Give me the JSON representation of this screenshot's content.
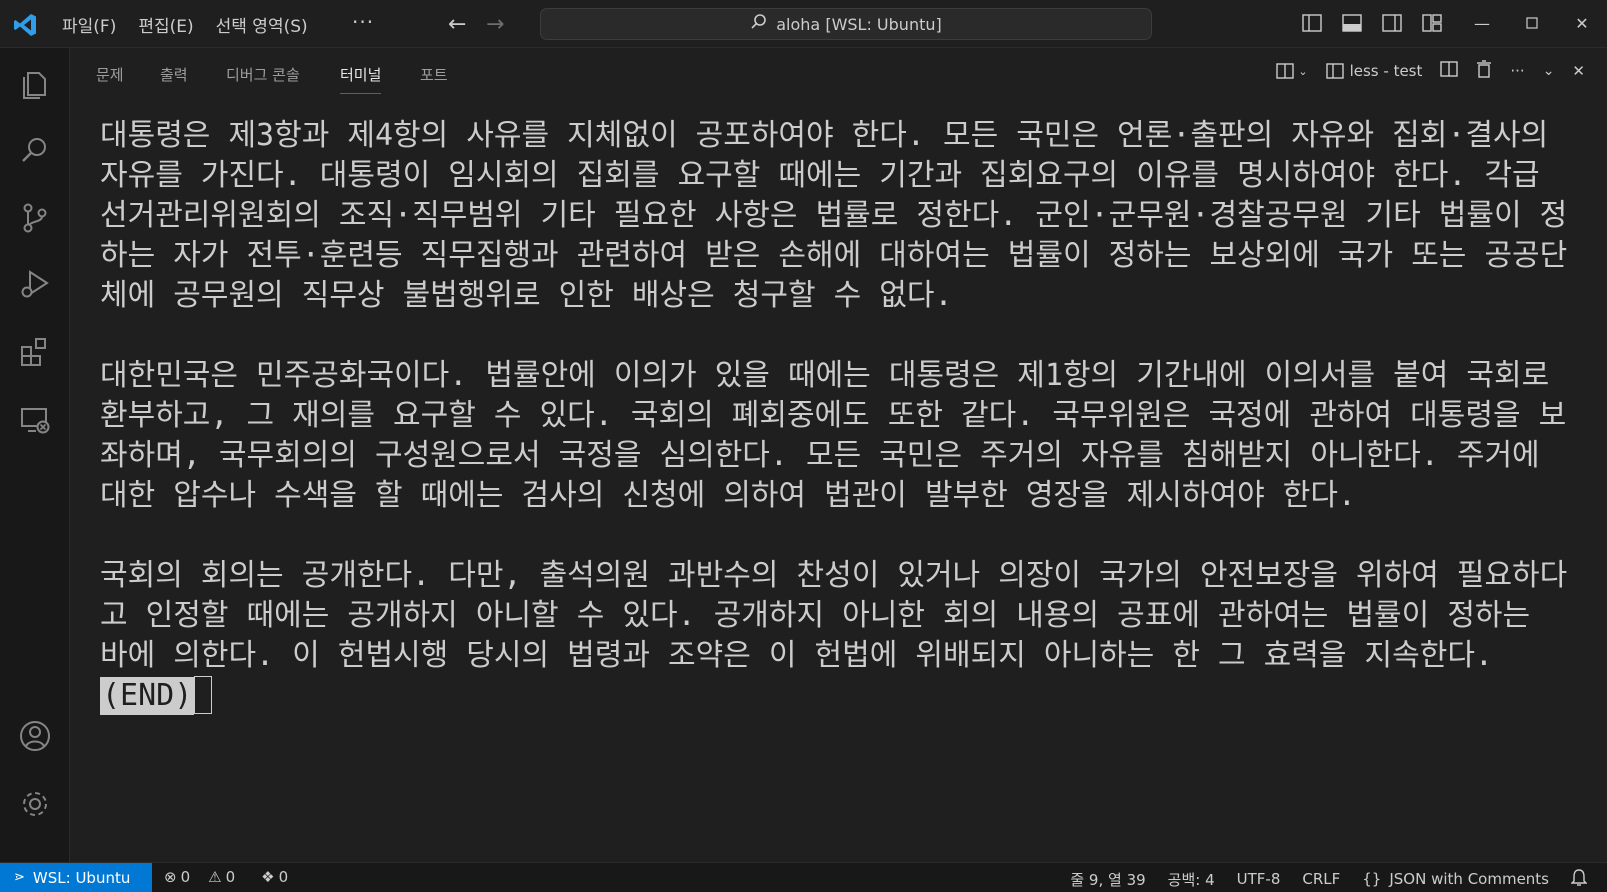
{
  "titlebar": {
    "menu": [
      "파일(F)",
      "편집(E)",
      "선택 영역(S)"
    ],
    "more": "···",
    "search_text": "aloha [WSL: Ubuntu]"
  },
  "panel": {
    "tabs": [
      "문제",
      "출력",
      "디버그 콘솔",
      "터미널",
      "포트"
    ],
    "active_tab": "터미널",
    "terminal_name": "less - test"
  },
  "terminal": {
    "paragraphs": [
      "대통령은 제3항과 제4항의 사유를 지체없이 공포하여야 한다. 모든 국민은 언론·출판의 자유와 집회·결사의 자유를 가진다. 대통령이 임시회의 집회를 요구할 때에는 기간과 집회요구의 이유를 명시하여야 한다. 각급 선거관리위원회의 조직·직무범위 기타 필요한 사항은 법률로 정한다. 군인·군무원·경찰공무원 기타 법률이 정하는 자가 전투·훈련등 직무집행과 관련하여 받은 손해에 대하여는 법률이 정하는 보상외에 국가 또는 공공단체에 공무원의 직무상 불법행위로 인한 배상은 청구할 수 없다.",
      "대한민국은 민주공화국이다. 법률안에 이의가 있을 때에는 대통령은 제1항의 기간내에 이의서를 붙여 국회로 환부하고, 그 재의를 요구할 수 있다. 국회의 폐회중에도 또한 같다. 국무위원은 국정에 관하여 대통령을 보좌하며, 국무회의의 구성원으로서 국정을 심의한다. 모든 국민은 주거의 자유를 침해받지 아니한다. 주거에 대한 압수나 수색을 할 때에는 검사의 신청에 의하여 법관이 발부한 영장을 제시하여야 한다.",
      "국회의 회의는 공개한다. 다만, 출석의원 과반수의 찬성이 있거나 의장이 국가의 안전보장을 위하여 필요하다고 인정할 때에는 공개하지 아니할 수 있다. 공개하지 아니한 회의 내용의 공표에 관하여는 법률이 정하는 바에 의한다. 이 헌법시행 당시의 법령과 조약은 이 헌법에 위배되지 아니하는 한 그 효력을 지속한다."
    ],
    "end_marker": "(END)"
  },
  "statusbar": {
    "remote": "WSL: Ubuntu",
    "errors": "0",
    "warnings": "0",
    "ports": "0",
    "position": "줄 9, 열 39",
    "spaces": "공백: 4",
    "encoding": "UTF-8",
    "eol": "CRLF",
    "language": "JSON with Comments"
  },
  "colors": {
    "accent": "#0078d4",
    "background": "#1f1f1f",
    "activity_bar": "#181818",
    "text": "#cccccc"
  },
  "icons": [
    "vscode-logo-icon",
    "back-arrow-icon",
    "forward-arrow-icon",
    "search-icon",
    "explorer-icon",
    "search-view-icon",
    "source-control-icon",
    "run-debug-icon",
    "extensions-icon",
    "remote-explorer-icon",
    "account-icon",
    "settings-gear-icon",
    "split-icon",
    "trash-icon",
    "close-icon",
    "bell-icon"
  ]
}
